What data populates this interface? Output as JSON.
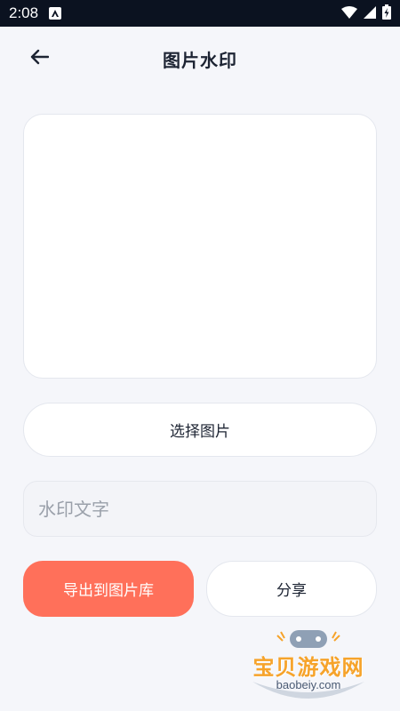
{
  "status_bar": {
    "time": "2:08",
    "app_icon": "a-icon",
    "icons": [
      "wifi-icon",
      "signal-icon",
      "battery-charging-icon"
    ]
  },
  "header": {
    "back_icon": "arrow-left-icon",
    "title": "图片水印"
  },
  "main": {
    "select_image_label": "选择图片",
    "watermark_placeholder": "水印文字",
    "watermark_value": "",
    "export_label": "导出到图片库",
    "share_label": "分享"
  },
  "watermark_logo": {
    "text": "宝贝游戏网",
    "url": "baobeiy.com"
  },
  "colors": {
    "background": "#f5f6fa",
    "accent": "#ff705a",
    "status_bar": "#0b1220",
    "logo_orange": "#f6a32a"
  }
}
